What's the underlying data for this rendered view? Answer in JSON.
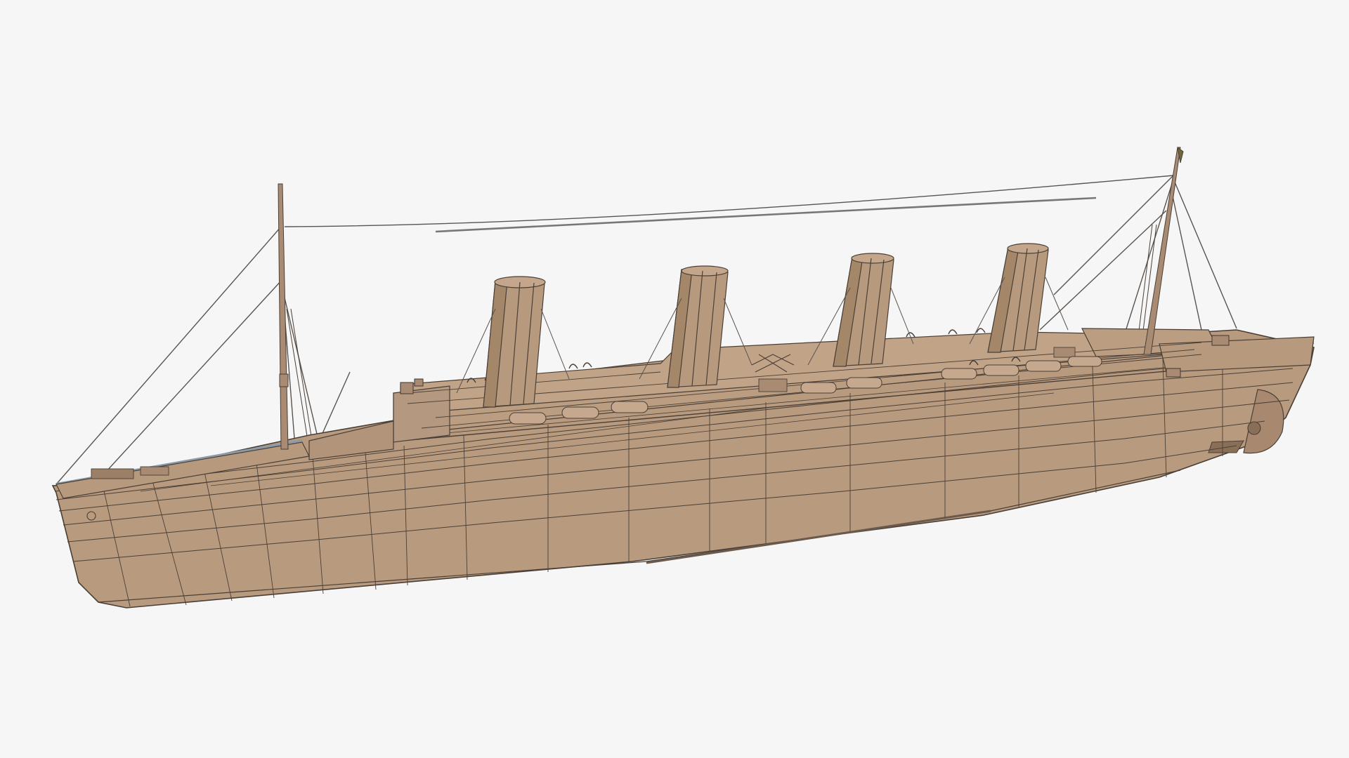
{
  "scene": {
    "subject": "ship-wireframe-model",
    "colors": {
      "background": "#f6f6f6",
      "hull": "#b89a7f",
      "hull_shade": "#a8896f",
      "superstructure": "#bb9d82",
      "funnel": "#b79a7e",
      "funnel_shade": "#a48669",
      "wire": "#4a3f36",
      "rigging": "#5a5450",
      "railing": "#8d9aa8",
      "flag": "#6e6a3a"
    },
    "counts": {
      "funnels": 4,
      "masts": 2,
      "lifeboats_per_side": 10
    }
  }
}
